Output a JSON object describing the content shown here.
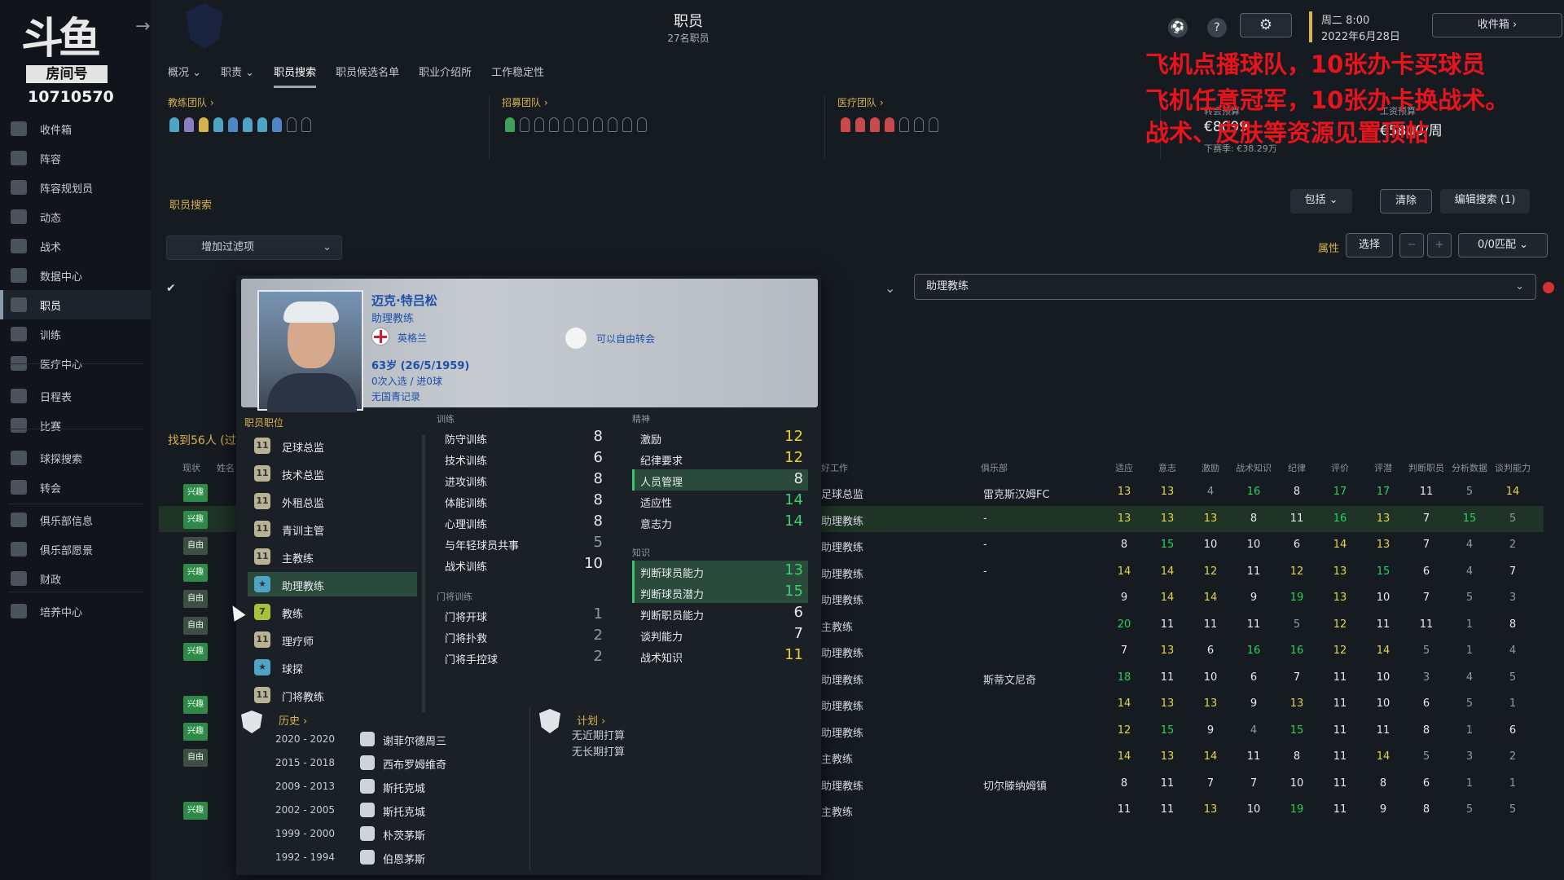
{
  "brand": {
    "logo": "斗鱼",
    "room_label": "房间号",
    "room_id": "10710570"
  },
  "header": {
    "title": "职员",
    "subtitle": "27名职员",
    "settings_icon": "gear-icon",
    "date_line1": "周二 8:00",
    "date_line2": "2022年6月28日",
    "inbox_label": "收件箱"
  },
  "sidebar": {
    "items": [
      {
        "label": "收件箱",
        "icon": "inbox-icon"
      },
      {
        "label": "阵容",
        "icon": "shirt-icon"
      },
      {
        "label": "阵容规划员",
        "icon": "clipboard-icon"
      },
      {
        "label": "动态",
        "icon": "refresh-icon"
      },
      {
        "label": "战术",
        "icon": "tactics-icon"
      },
      {
        "label": "数据中心",
        "icon": "data-icon"
      },
      {
        "label": "职员",
        "icon": "staff-icon",
        "active": true
      },
      {
        "label": "训练",
        "icon": "training-icon"
      },
      {
        "label": "医疗中心",
        "icon": "medical-icon"
      },
      {
        "label": "日程表",
        "icon": "calendar-icon"
      },
      {
        "label": "比赛",
        "icon": "trophy-icon"
      },
      {
        "label": "球探搜索",
        "icon": "search-icon"
      },
      {
        "label": "转会",
        "icon": "transfer-icon"
      },
      {
        "label": "俱乐部信息",
        "icon": "shield-icon"
      },
      {
        "label": "俱乐部愿景",
        "icon": "vision-icon"
      },
      {
        "label": "财政",
        "icon": "finance-icon"
      },
      {
        "label": "培养中心",
        "icon": "development-icon"
      }
    ]
  },
  "tabs": [
    {
      "label": "概况 ⌄"
    },
    {
      "label": "职责 ⌄"
    },
    {
      "label": "职员搜索",
      "active": true
    },
    {
      "label": "职员候选名单"
    },
    {
      "label": "职业介绍所"
    },
    {
      "label": "工作稳定性"
    }
  ],
  "groups": {
    "coaching": "教练团队 ›",
    "recruitment": "招募团队 ›",
    "medical": "医疗团队 ›"
  },
  "budget": {
    "transfer_label": "转会预算",
    "transfer_value": "€8099",
    "wage_label": "工资预算",
    "wage_value": "€5800/周",
    "next_season": "下赛季: €38.29万"
  },
  "overlay": {
    "line1": "飞机点播球队，10张办卡买球员",
    "line2": "飞机任意冠军，10张办卡换战术。",
    "line3": "战术、皮肤等资源见置顶帖"
  },
  "search": {
    "section_title": "职员搜索",
    "include_label": "包括 ⌄",
    "clear_label": "清除",
    "edit_label": "编辑搜索 (1)",
    "add_filter": "增加过滤项",
    "attr_label": "属性",
    "select_label": "选择",
    "minus": "−",
    "plus": "+",
    "match_label": "0/0匹配 ⌄",
    "role_value": "助理教练",
    "found": "找到56人 (过"
  },
  "table": {
    "col_status": "现状",
    "col_name": "姓名",
    "col_job": "好工作",
    "col_club": "俱乐部",
    "attr_headers": [
      "适应",
      "意志",
      "激励",
      "战术知识",
      "纪律",
      "评价",
      "评潜",
      "判断职员",
      "分析数据",
      "谈判能力"
    ],
    "rows": [
      {
        "status": "兴趣",
        "job": "足球总监",
        "club": "雷克斯汉姆FC",
        "v": [
          13,
          13,
          4,
          16,
          8,
          17,
          17,
          11,
          5,
          14
        ]
      },
      {
        "status": "兴趣",
        "job": "助理教练",
        "club": "-",
        "v": [
          13,
          13,
          13,
          8,
          11,
          16,
          13,
          7,
          15,
          5
        ],
        "hl": true
      },
      {
        "status": "自由",
        "job": "助理教练",
        "club": "-",
        "v": [
          8,
          15,
          10,
          10,
          6,
          14,
          13,
          7,
          4,
          2
        ]
      },
      {
        "status": "兴趣",
        "job": "助理教练",
        "club": "-",
        "v": [
          14,
          14,
          12,
          11,
          12,
          13,
          15,
          6,
          4,
          7
        ]
      },
      {
        "status": "自由",
        "job": "助理教练",
        "club": "",
        "v": [
          9,
          14,
          14,
          9,
          19,
          13,
          10,
          7,
          5,
          3
        ]
      },
      {
        "status": "自由",
        "job": "主教练",
        "club": "",
        "v": [
          20,
          11,
          11,
          11,
          5,
          12,
          11,
          11,
          1,
          8
        ]
      },
      {
        "status": "兴趣",
        "job": "助理教练",
        "club": "",
        "v": [
          7,
          13,
          6,
          16,
          16,
          12,
          14,
          5,
          1,
          4
        ]
      },
      {
        "status": "",
        "job": "助理教练",
        "club": "斯蒂文尼奇",
        "v": [
          18,
          11,
          10,
          6,
          7,
          11,
          10,
          3,
          4,
          5
        ]
      },
      {
        "status": "兴趣",
        "job": "助理教练",
        "club": "",
        "v": [
          14,
          13,
          13,
          9,
          13,
          11,
          10,
          6,
          5,
          1
        ]
      },
      {
        "status": "兴趣",
        "job": "助理教练",
        "club": "",
        "v": [
          12,
          15,
          9,
          4,
          15,
          11,
          11,
          8,
          1,
          6
        ]
      },
      {
        "status": "自由",
        "job": "主教练",
        "club": "",
        "v": [
          14,
          13,
          14,
          11,
          8,
          11,
          14,
          5,
          3,
          2
        ]
      },
      {
        "status": "",
        "job": "助理教练",
        "club": "切尔滕纳姆镇",
        "v": [
          8,
          11,
          7,
          7,
          10,
          11,
          8,
          6,
          1,
          1
        ]
      },
      {
        "status": "兴趣",
        "job": "主教练",
        "club": "",
        "v": [
          11,
          11,
          13,
          10,
          19,
          11,
          9,
          8,
          5,
          5
        ]
      }
    ]
  },
  "profile": {
    "name": "迈克·特吕松",
    "role": "助理教练",
    "nation": "英格兰",
    "transfer_status": "可以自由转会",
    "age": "63岁 (26/5/1959)",
    "internationals": "0次入选 / 进0球",
    "youth": "无国青记录",
    "positions_title": "职员职位",
    "positions": [
      {
        "label": "足球总监",
        "badge": "11"
      },
      {
        "label": "技术总监",
        "badge": "11"
      },
      {
        "label": "外租总监",
        "badge": "11"
      },
      {
        "label": "青训主管",
        "badge": "11"
      },
      {
        "label": "主教练",
        "badge": "11"
      },
      {
        "label": "助理教练",
        "badge": "★",
        "active": true
      },
      {
        "label": "教练",
        "badge": "7"
      },
      {
        "label": "理疗师",
        "badge": "11"
      },
      {
        "label": "球探",
        "badge": "★"
      },
      {
        "label": "门将教练",
        "badge": "11"
      }
    ],
    "training_title": "训练",
    "training": [
      {
        "name": "防守训练",
        "value": 8
      },
      {
        "name": "技术训练",
        "value": 6
      },
      {
        "name": "进攻训练",
        "value": 8
      },
      {
        "name": "体能训练",
        "value": 8
      },
      {
        "name": "心理训练",
        "value": 8
      },
      {
        "name": "与年轻球员共事",
        "value": 5
      },
      {
        "name": "战术训练",
        "value": 10
      }
    ],
    "gk_title": "门将训练",
    "gk": [
      {
        "name": "门将开球",
        "value": 1
      },
      {
        "name": "门将扑救",
        "value": 2
      },
      {
        "name": "门将手控球",
        "value": 2
      }
    ],
    "mental_title": "精神",
    "mental": [
      {
        "name": "激励",
        "value": 12
      },
      {
        "name": "纪律要求",
        "value": 12
      },
      {
        "name": "人员管理",
        "value": 8,
        "hl": true
      },
      {
        "name": "适应性",
        "value": 14
      },
      {
        "name": "意志力",
        "value": 14
      }
    ],
    "knowledge_title": "知识",
    "knowledge": [
      {
        "name": "判断球员能力",
        "value": 13,
        "hl": true
      },
      {
        "name": "判断球员潜力",
        "value": 15,
        "hl": true
      },
      {
        "name": "判断职员能力",
        "value": 6
      },
      {
        "name": "谈判能力",
        "value": 7
      },
      {
        "name": "战术知识",
        "value": 11
      }
    ],
    "history_title": "历史 ›",
    "history": [
      {
        "years": "2020 - 2020",
        "club": "谢菲尔德周三"
      },
      {
        "years": "2015 - 2018",
        "club": "西布罗姆维奇"
      },
      {
        "years": "2009 - 2013",
        "club": "斯托克城"
      },
      {
        "years": "2002 - 2005",
        "club": "斯托克城"
      },
      {
        "years": "1999 - 2000",
        "club": "朴茨茅斯"
      },
      {
        "years": "1992 - 1994",
        "club": "伯恩茅斯"
      }
    ],
    "plan_title": "计划 ›",
    "plan_near": "无近期打算",
    "plan_long": "无长期打算"
  }
}
